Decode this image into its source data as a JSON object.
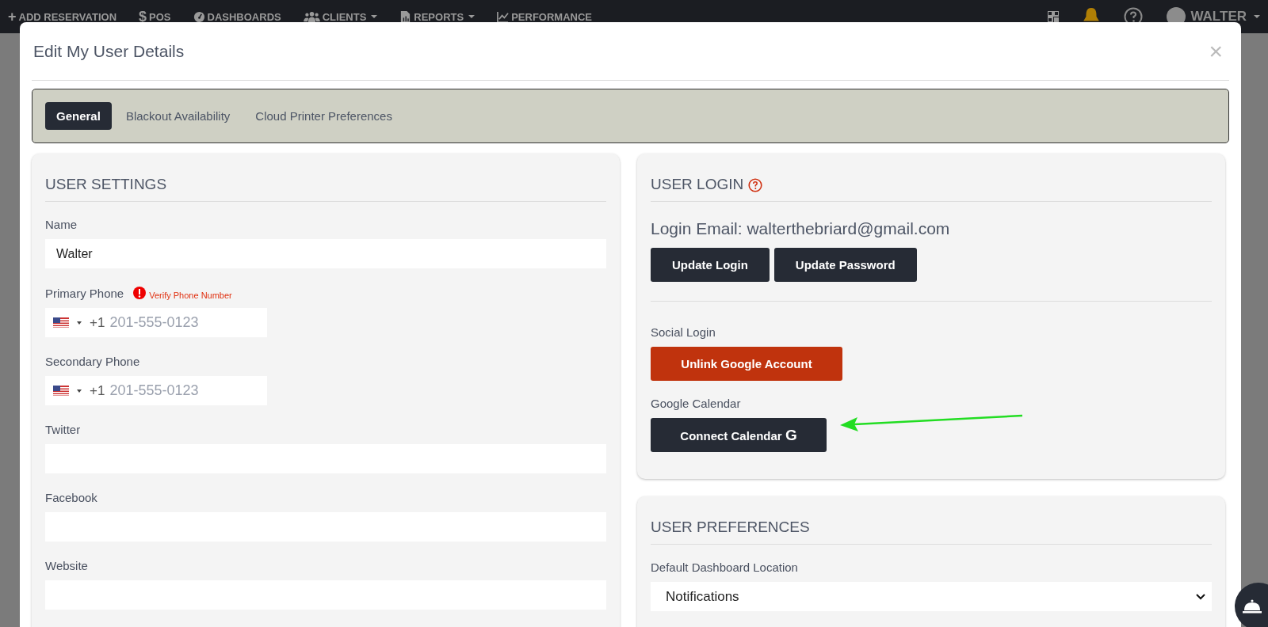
{
  "nav": {
    "items": [
      {
        "label": "ADD RESERVATION",
        "glyph": "+",
        "dropdown": false
      },
      {
        "label": "POS",
        "glyph": "$",
        "dropdown": false
      },
      {
        "label": "DASHBOARDS",
        "dropdown": false
      },
      {
        "label": "CLIENTS",
        "dropdown": true
      },
      {
        "label": "REPORTS",
        "dropdown": true
      },
      {
        "label": "PERFORMANCE",
        "dropdown": false
      }
    ],
    "user": {
      "name": "WALTER",
      "dropdown": true
    }
  },
  "modal": {
    "title": "Edit My User Details",
    "close": "×"
  },
  "tabs": [
    {
      "label": "General",
      "selected": true
    },
    {
      "label": "Blackout Availability",
      "selected": false
    },
    {
      "label": "Cloud Printer Preferences",
      "selected": false
    }
  ],
  "user_settings": {
    "heading": "USER SETTINGS",
    "fields": [
      {
        "kind": "text",
        "label": "Name",
        "value": "Walter"
      },
      {
        "kind": "phone",
        "label": "Primary Phone",
        "code": "+1",
        "placeholder": "201-555-0123",
        "warning": "Verify Phone Number"
      },
      {
        "kind": "phone",
        "label": "Secondary Phone",
        "code": "+1",
        "placeholder": "201-555-0123"
      },
      {
        "kind": "text",
        "label": "Twitter"
      },
      {
        "kind": "text",
        "label": "Facebook"
      },
      {
        "kind": "text",
        "label": "Website"
      }
    ]
  },
  "user_login": {
    "heading": "USER LOGIN",
    "email_line": "Login Email: walterthebriard@gmail.com",
    "buttons": [
      "Update Login",
      "Update Password"
    ],
    "social_label": "Social Login",
    "social_button": "Unlink Google Account",
    "calendar_label": "Google Calendar",
    "calendar_button": "Connect Calendar",
    "calendar_button_glyph": "G"
  },
  "user_preferences": {
    "heading": "USER PREFERENCES",
    "fields": [
      {
        "label": "Default Dashboard Location",
        "value": "Notifications"
      }
    ]
  }
}
